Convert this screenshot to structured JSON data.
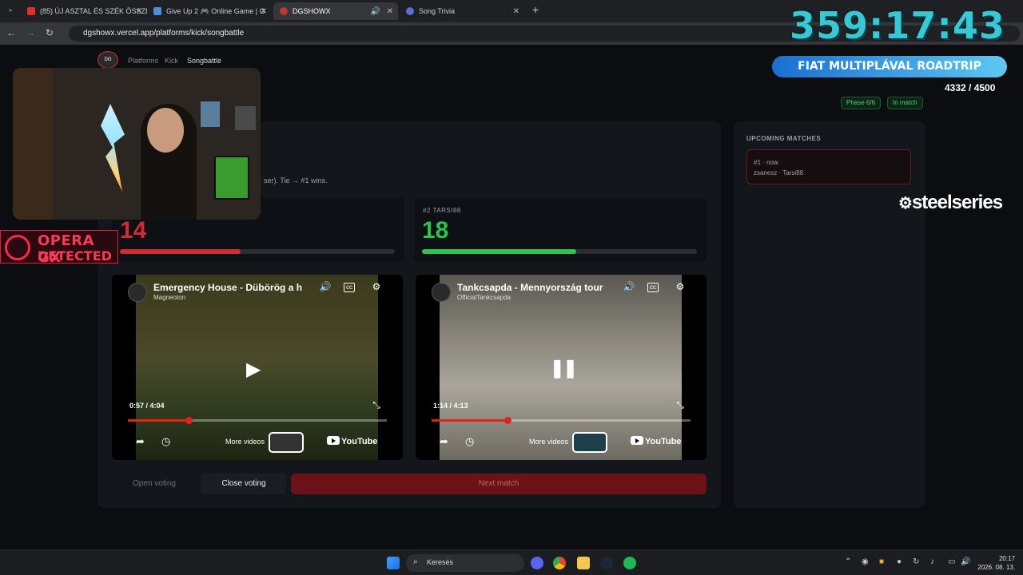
{
  "browser": {
    "tabs": [
      {
        "title": "(85) ÚJ ASZTAL ÉS SZÉK ÖSSZE",
        "favicon_color": "#e52d27"
      },
      {
        "title": "Give Up 2 🎮 Online Game | G",
        "favicon_color": "#4a90e2"
      },
      {
        "title": "DGSHOWX",
        "favicon_color": "#c0392b"
      },
      {
        "title": "Song Trivia",
        "favicon_color": "#5b6cd9"
      }
    ],
    "url": "dgshowx.vercel.app/platforms/kick/songbattle"
  },
  "stream_timer": "359:17:43",
  "breadcrumb": {
    "logo": "DG SHOWX",
    "items": [
      "Platforms",
      "Kick",
      "Songbattle"
    ]
  },
  "status": {
    "phase": "Phase 6/6",
    "state": "In match"
  },
  "rules_text": "ser). Tie → #1 wins.",
  "contestants": [
    {
      "label": "",
      "score": "14",
      "bar_fraction": 0.44,
      "color": "#d12b33"
    },
    {
      "label": "#2 TARSI88",
      "score": "18",
      "bar_fraction": 0.56,
      "color": "#2bc44f"
    }
  ],
  "videos": [
    {
      "title": "Emergency House - Dübörög a h",
      "channel": "Magneoton",
      "time": "0:57 / 4:04",
      "progress": 0.235,
      "state": "paused",
      "more_videos": "More videos",
      "brand": "YouTube"
    },
    {
      "title": "Tankcsapda - Mennyország tour",
      "channel": "OfficialTankcsapda",
      "time": "1:14 / 4:13",
      "progress": 0.292,
      "state": "playing",
      "more_videos": "More videos",
      "brand": "YouTube"
    }
  ],
  "actions": {
    "open_voting": "Open voting",
    "close_voting": "Close voting",
    "next_match": "Next match"
  },
  "upcoming": {
    "title": "UPCOMING MATCHES",
    "matches": [
      {
        "num": "#1 · now",
        "players": "zsanesz · Tarsi88"
      }
    ]
  },
  "overlays": {
    "opera_line1": "OPERA GX",
    "opera_line2": "DETECTED",
    "goal_title": "FIAT MULTIPLÁVAL ROADTRIP",
    "goal_progress": "4332 / 4500",
    "sponsor": "steelseries"
  },
  "taskbar": {
    "search_placeholder": "Keresés",
    "time": "20:17",
    "date": "2026. 08. 13."
  }
}
